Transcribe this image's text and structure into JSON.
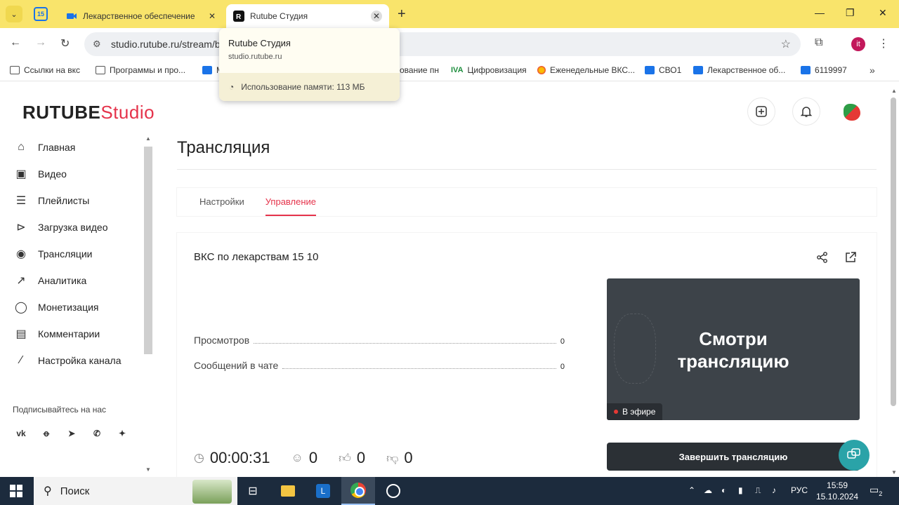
{
  "browser": {
    "tabs": [
      {
        "label": "Лекарственное обеспечение",
        "close": "✕"
      },
      {
        "label": "Rutube Студия",
        "close": "✕"
      }
    ],
    "calendar_badge": "15",
    "new_tab": "+",
    "window_controls": {
      "minimize": "—",
      "restore": "❐",
      "close": "✕"
    },
    "url": "studio.rutube.ru/stream/b",
    "profile_letter": "it",
    "bookmarks": [
      {
        "label": "Ссылки на вкс",
        "icon": "folder-icon"
      },
      {
        "label": "Программы и про...",
        "icon": "folder-icon"
      },
      {
        "label": "М",
        "icon": "lk-icon"
      },
      {
        "label": "ование пн",
        "icon": "none"
      },
      {
        "label": "Цифровизация",
        "icon": "ma-icon"
      },
      {
        "label": "Еженедельные ВКС...",
        "icon": "colorful-icon"
      },
      {
        "label": "СВО1",
        "icon": "camera-icon"
      },
      {
        "label": "Лекарственное об...",
        "icon": "camera-icon"
      },
      {
        "label": "6119997",
        "icon": "camera-icon"
      }
    ],
    "hover_card": {
      "title": "Rutube Студия",
      "url": "studio.rutube.ru",
      "memory": "Использование памяти: 113 МБ"
    }
  },
  "app": {
    "logo_main": "RUTUBE",
    "logo_studio": "Studio",
    "sidebar": [
      {
        "label": "Главная",
        "icon": "home-icon"
      },
      {
        "label": "Видео",
        "icon": "video-icon"
      },
      {
        "label": "Плейлисты",
        "icon": "playlist-icon"
      },
      {
        "label": "Загрузка видео",
        "icon": "upload-icon"
      },
      {
        "label": "Трансляции",
        "icon": "broadcast-icon"
      },
      {
        "label": "Аналитика",
        "icon": "analytics-icon"
      },
      {
        "label": "Монетизация",
        "icon": "coin-icon"
      },
      {
        "label": "Комментарии",
        "icon": "comments-icon"
      },
      {
        "label": "Настройка канала",
        "icon": "wand-icon"
      }
    ],
    "subscribe_label": "Подписывайтесь на нас",
    "socials": [
      "vk",
      "ok",
      "tg",
      "viber",
      "+"
    ],
    "page_title": "Трансляция",
    "tabs": [
      {
        "label": "Настройки",
        "active": false
      },
      {
        "label": "Управление",
        "active": true
      }
    ],
    "stream": {
      "name": "ВКС по лекарствам 15 10",
      "stats": [
        {
          "label": "Просмотров",
          "value": "0"
        },
        {
          "label": "Сообщений в чате",
          "value": "0"
        }
      ],
      "preview_line1": "Смотри",
      "preview_line2": "трансляцию",
      "live_label": "В эфире",
      "end_button": "Завершить трансляцию",
      "duration": "00:00:31",
      "viewers": "0",
      "likes": "0",
      "dislikes": "0"
    },
    "accent_color": "#e5334b"
  },
  "taskbar": {
    "search_placeholder": "Поиск",
    "lang": "РУС",
    "time": "15:59",
    "date": "15.10.2024",
    "notifications": "2"
  }
}
